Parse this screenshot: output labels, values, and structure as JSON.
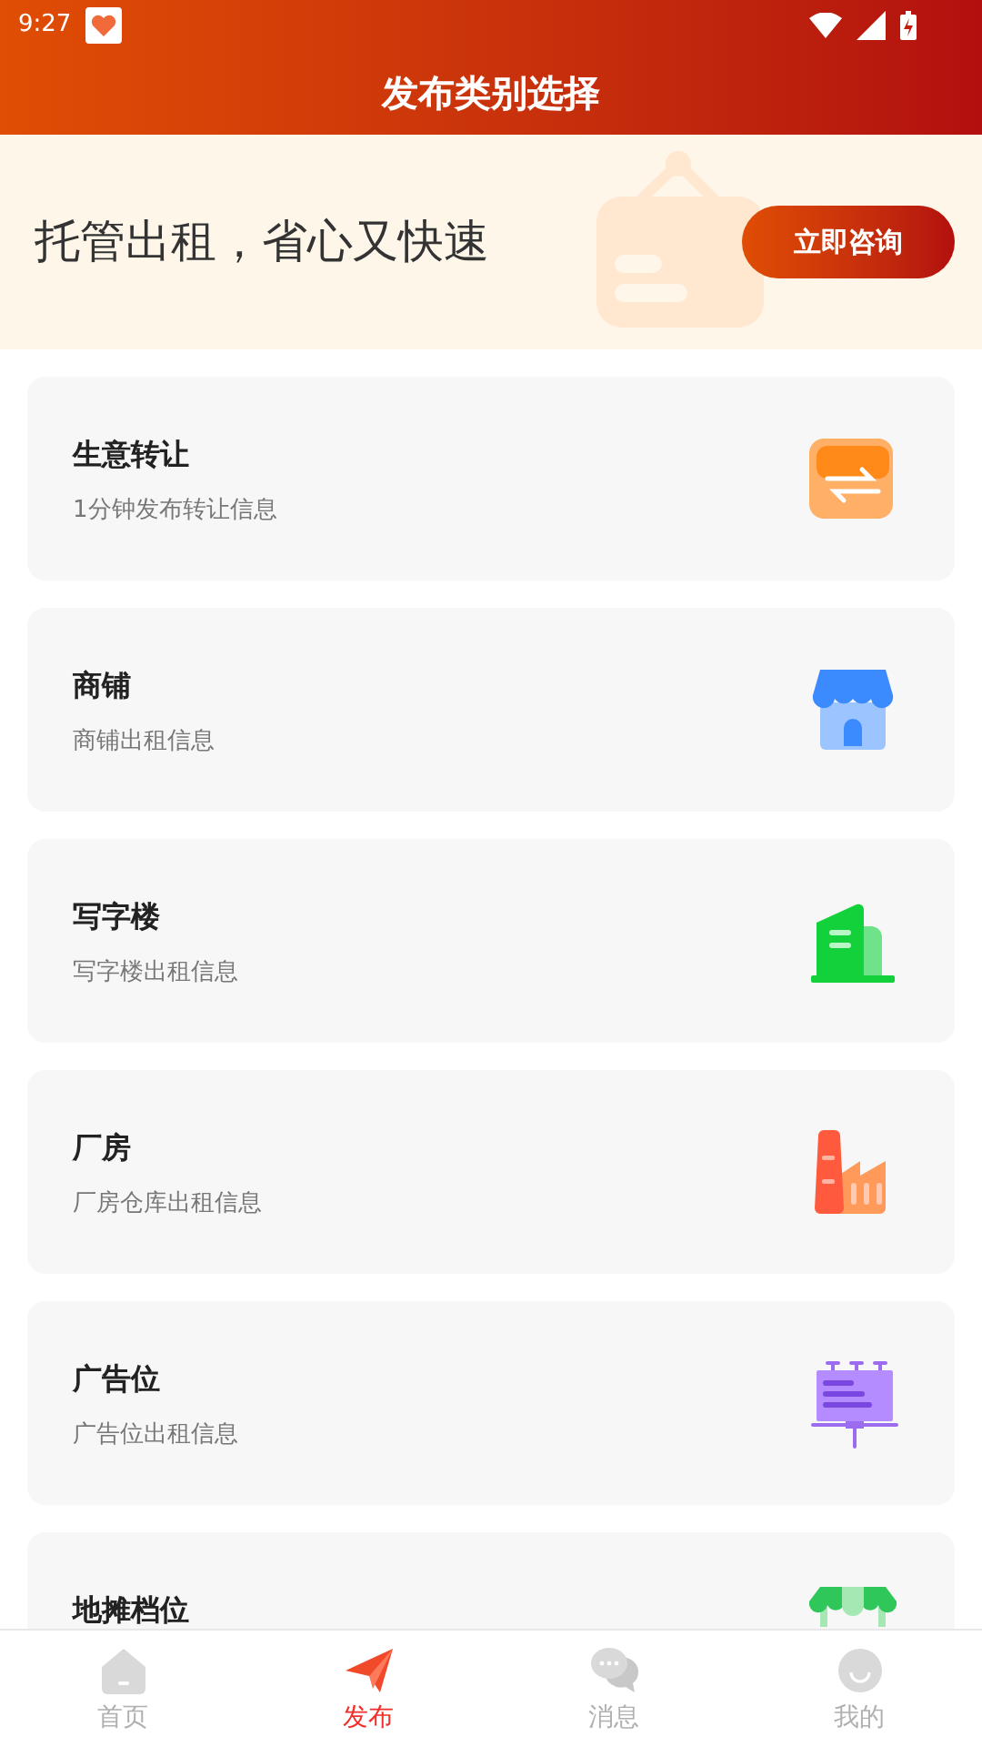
{
  "status_bar": {
    "time": "9:27"
  },
  "header": {
    "title": "发布类别选择"
  },
  "banner": {
    "text": "托管出租，省心又快速",
    "button": "立即咨询"
  },
  "categories": [
    {
      "kind": "transfer",
      "title": "生意转让",
      "subtitle": "1分钟发布转让信息"
    },
    {
      "kind": "shop",
      "title": "商铺",
      "subtitle": "商铺出租信息"
    },
    {
      "kind": "office",
      "title": "写字楼",
      "subtitle": "写字楼出租信息"
    },
    {
      "kind": "factory",
      "title": "厂房",
      "subtitle": "厂房仓库出租信息"
    },
    {
      "kind": "billboard",
      "title": "广告位",
      "subtitle": "广告位出租信息"
    },
    {
      "kind": "stall",
      "title": "地摊档位"
    }
  ],
  "tab_bar": [
    {
      "kind": "home",
      "label": "首页",
      "selected": false
    },
    {
      "kind": "publish",
      "label": "发布",
      "selected": true
    },
    {
      "kind": "messages",
      "label": "消息",
      "selected": false
    },
    {
      "kind": "profile",
      "label": "我的",
      "selected": false
    }
  ]
}
